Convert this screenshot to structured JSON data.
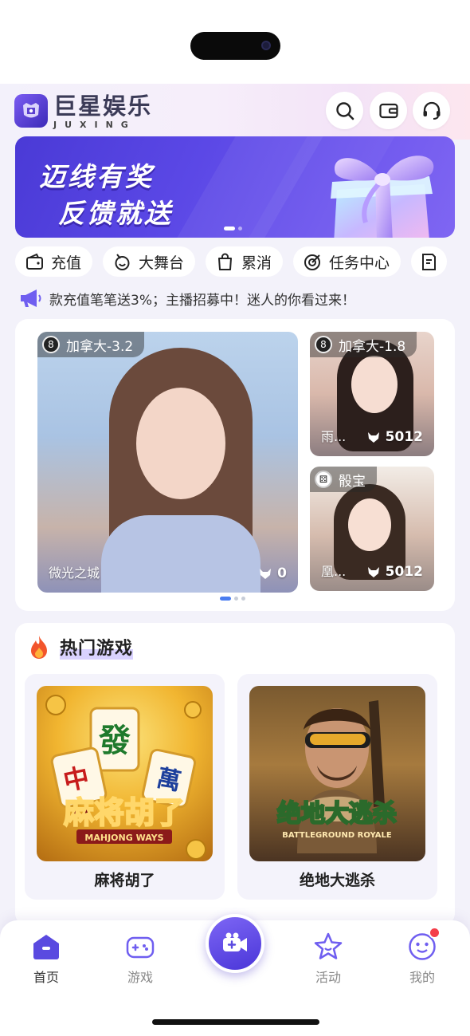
{
  "header": {
    "brand_cn": "巨星娱乐",
    "brand_en": "JUXING",
    "icons": [
      "search-icon",
      "wallet-icon",
      "headset-icon"
    ]
  },
  "banner": {
    "line1": "迈线有奖",
    "line2": "反馈就送",
    "page_count": 2,
    "active_page": 1
  },
  "quick_nav": [
    {
      "label": "充值",
      "icon": "recharge-wallet-icon"
    },
    {
      "label": "大舞台",
      "icon": "stage-icon"
    },
    {
      "label": "累消",
      "icon": "shopping-bag-icon"
    },
    {
      "label": "任务中心",
      "icon": "target-icon"
    },
    {
      "label": "",
      "icon": "document-edit-icon"
    }
  ],
  "notice": {
    "icon": "megaphone-icon",
    "text": "款充值笔笔送3%；主播招募中！迷人的你看过来！"
  },
  "live": {
    "rooms": [
      {
        "tag": "加拿大-3.2",
        "tag_icon": "8-ball-icon",
        "name": "微光之城",
        "count": "0"
      },
      {
        "tag": "加拿大-1.8",
        "tag_icon": "8-ball-icon",
        "name": "雨...",
        "count": "5012"
      },
      {
        "tag": "骰宝",
        "tag_icon": "dice-icon",
        "name": "凰...",
        "count": "5012"
      }
    ],
    "page_count": 3,
    "active_page": 1
  },
  "hot_games": {
    "title": "热门游戏",
    "games": [
      {
        "name": "麻将胡了",
        "art_text": "麻将胡了",
        "art_sub": "MAHJONG WAYS"
      },
      {
        "name": "绝地大逃杀",
        "art_text": "绝地大逃杀",
        "art_sub": "BATTLEGROUND ROYALE"
      }
    ]
  },
  "tabbar": {
    "tabs": [
      {
        "label": "首页",
        "icon": "home-icon",
        "active": true
      },
      {
        "label": "游戏",
        "icon": "gamepad-icon",
        "active": false
      },
      {
        "label": "",
        "icon": "video-camera-icon",
        "active": false
      },
      {
        "label": "活动",
        "icon": "star-icon",
        "active": false
      },
      {
        "label": "我的",
        "icon": "profile-face-icon",
        "active": false,
        "badge": true
      }
    ]
  },
  "colors": {
    "accent": "#5b48e6",
    "active_tab": "#5a4ae0",
    "badge": "#f43d4a",
    "background": "#f3f2fa"
  }
}
